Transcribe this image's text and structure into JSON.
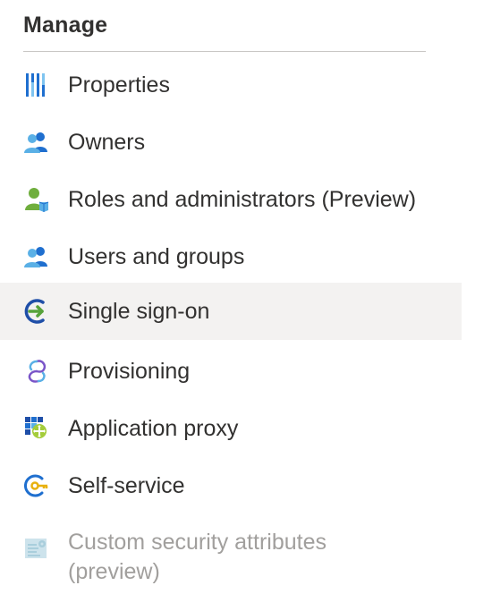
{
  "section": {
    "title": "Manage"
  },
  "items": [
    {
      "label": "Properties",
      "icon": "properties-icon"
    },
    {
      "label": "Owners",
      "icon": "owners-icon"
    },
    {
      "label": "Roles and administrators (Preview)",
      "icon": "roles-admin-icon"
    },
    {
      "label": "Users and groups",
      "icon": "users-groups-icon"
    },
    {
      "label": "Single sign-on",
      "icon": "single-sign-on-icon",
      "selected": true
    },
    {
      "label": "Provisioning",
      "icon": "provisioning-icon"
    },
    {
      "label": "Application proxy",
      "icon": "application-proxy-icon"
    },
    {
      "label": "Self-service",
      "icon": "self-service-icon"
    },
    {
      "label": "Custom security attributes (preview)",
      "icon": "custom-security-attributes-icon",
      "disabled": true
    }
  ],
  "colors": {
    "selected_background": "#f3f2f1",
    "text": "#323130",
    "disabled_text": "#a19f9d",
    "divider": "#c8c6c4"
  }
}
